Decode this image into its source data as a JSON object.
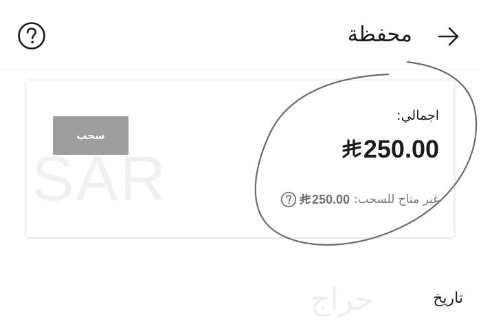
{
  "header": {
    "title": "محفظة",
    "back_icon": "arrow-right-icon",
    "help_icon": "question-circle-icon"
  },
  "wallet": {
    "watermark": "SAR",
    "withdraw_label": "سحب",
    "total_label": "اجمالي:",
    "total_amount": "250.00",
    "unavailable_label": "غير متاح للسحب:",
    "unavailable_amount": "250.00",
    "currency_icon": "riyal-symbol-icon",
    "info_icon": "question-circle-icon"
  },
  "history": {
    "title": "تاريخ"
  },
  "watermark_site": "حراج",
  "colors": {
    "withdraw_button": "#9e9e9e",
    "text_primary": "#1b1b1b",
    "text_muted": "#777777",
    "annotation_stroke": "#6a6a6a"
  }
}
